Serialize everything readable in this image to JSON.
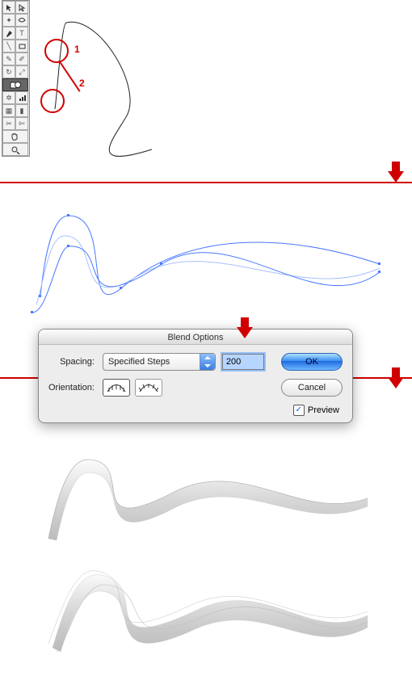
{
  "annotations": {
    "label1": "1",
    "label2": "2"
  },
  "dialog": {
    "title": "Blend Options",
    "spacing_label": "Spacing:",
    "orientation_label": "Orientation:",
    "spacing_mode": "Specified Steps",
    "steps_value": "200",
    "ok_label": "OK",
    "cancel_label": "Cancel",
    "preview_label": "Preview",
    "preview_checked": true
  },
  "icons": {
    "toolbar_tools": [
      "selection-tool",
      "direct-selection-tool",
      "magic-wand-tool",
      "lasso-tool",
      "pen-tool",
      "type-tool",
      "line-segment-tool",
      "rectangle-tool",
      "paintbrush-tool",
      "pencil-tool",
      "rotate-tool",
      "scale-tool",
      "warp-tool",
      "free-transform-tool",
      "symbol-sprayer-tool",
      "column-graph-tool",
      "mesh-tool",
      "gradient-tool",
      "eyedropper-tool",
      "blend-tool",
      "slice-tool",
      "scissors-tool",
      "hand-tool",
      "zoom-tool"
    ],
    "orientation_align_page": "align-to-page-icon",
    "orientation_align_path": "align-to-path-icon"
  },
  "colors": {
    "accent_red": "#d00000",
    "aqua_blue": "#3a8ff0",
    "select_highlight": "#b6d6ff",
    "path_blue": "#4a78ff",
    "path_blue_light": "#a9c0ff",
    "wave_grey": "#dedede"
  }
}
